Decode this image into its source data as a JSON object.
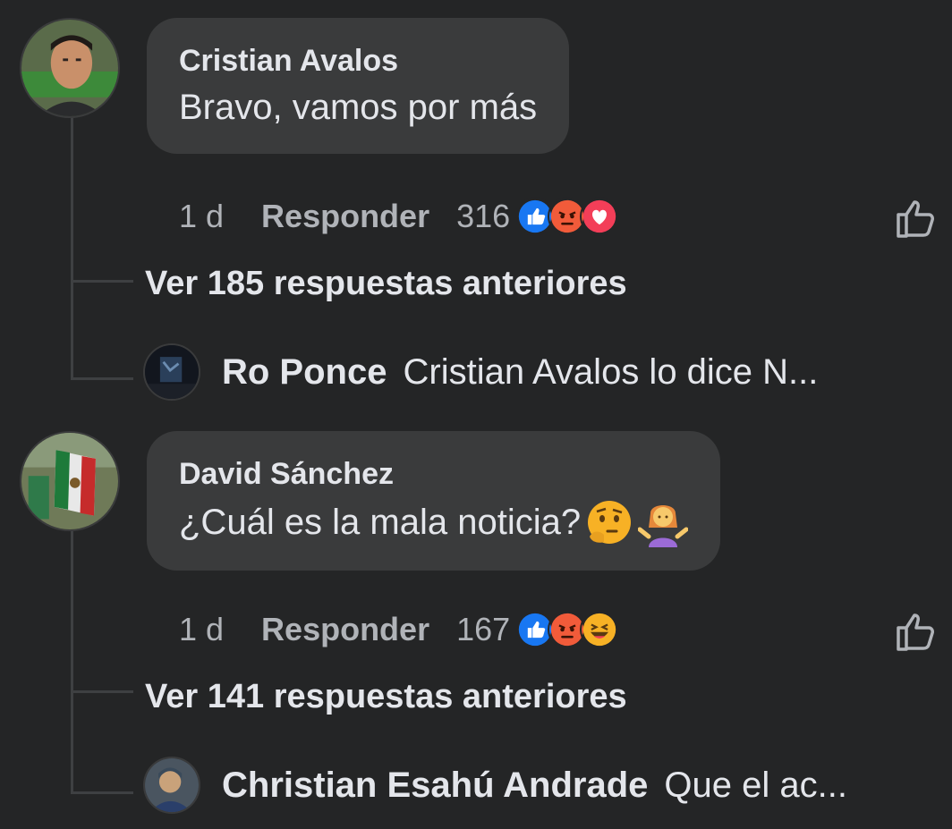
{
  "comments": [
    {
      "author": "Cristian Avalos",
      "text": "Bravo, vamos por más",
      "time": "1 d",
      "reply_label": "Responder",
      "reaction_count": "316",
      "reactions": [
        "like",
        "angry",
        "love"
      ],
      "view_replies": "Ver 185 respuestas anteriores",
      "reply_preview": {
        "author": "Ro Ponce",
        "text": "Cristian Avalos lo dice N..."
      }
    },
    {
      "author": "David Sánchez",
      "text": "¿Cuál es la mala noticia?",
      "emojis": [
        "thinking-face-emoji",
        "woman-shrugging-emoji"
      ],
      "time": "1 d",
      "reply_label": "Responder",
      "reaction_count": "167",
      "reactions": [
        "like",
        "angry",
        "haha"
      ],
      "view_replies": "Ver 141 respuestas anteriores",
      "reply_preview": {
        "author": "Christian Esahú Andrade",
        "text": "Que el ac..."
      }
    }
  ],
  "colors": {
    "background": "#242526",
    "bubble": "#3a3b3c",
    "primary_text": "#e4e6eb",
    "secondary_text": "#b0b3b8",
    "like_blue": "#1877f2",
    "angry_orange": "#f15b3a",
    "love_red": "#f33e58",
    "haha_yellow": "#f7b125"
  }
}
